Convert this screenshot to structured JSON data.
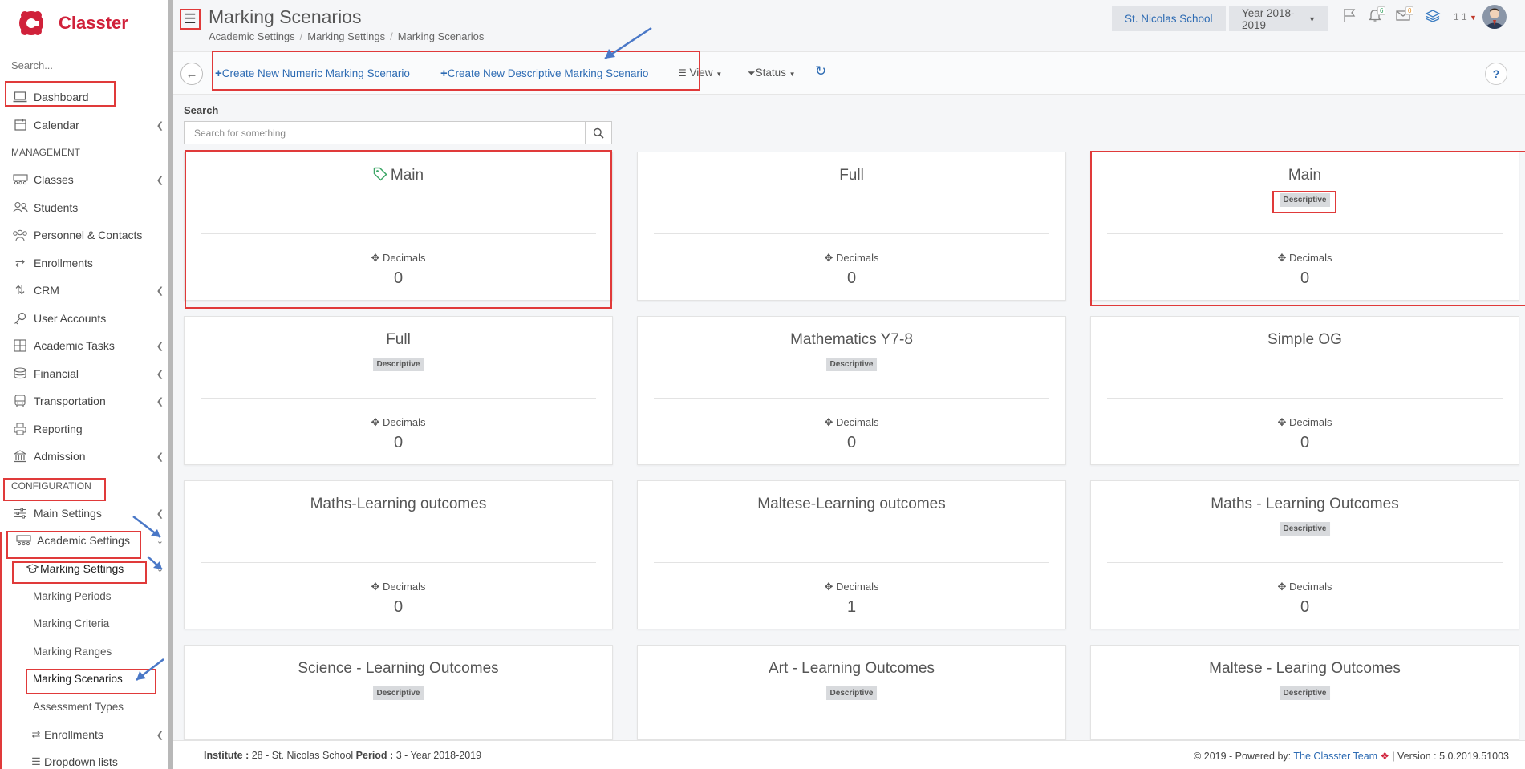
{
  "app": {
    "name": "Classter"
  },
  "sidebar": {
    "search_placeholder": "Search...",
    "items_top": [
      {
        "label": "Dashboard",
        "icon": "laptop-icon"
      },
      {
        "label": "Calendar",
        "icon": "calendar-icon"
      }
    ],
    "management_label": "MANAGEMENT",
    "management": [
      {
        "label": "Classes",
        "icon": "classes-icon"
      },
      {
        "label": "Students",
        "icon": "students-icon"
      },
      {
        "label": "Personnel & Contacts",
        "icon": "personnel-icon"
      },
      {
        "label": "Enrollments",
        "icon": "enrollments-icon"
      },
      {
        "label": "CRM",
        "icon": "crm-icon"
      },
      {
        "label": "User Accounts",
        "icon": "key-icon"
      },
      {
        "label": "Academic Tasks",
        "icon": "tasks-icon"
      },
      {
        "label": "Financial",
        "icon": "financial-icon"
      },
      {
        "label": "Transportation",
        "icon": "bus-icon"
      },
      {
        "label": "Reporting",
        "icon": "printer-icon"
      },
      {
        "label": "Admission",
        "icon": "institution-icon"
      }
    ],
    "configuration_label": "CONFIGURATION",
    "configuration": {
      "main_settings": "Main Settings",
      "academic_settings": "Academic Settings",
      "marking_settings": "Marking Settings",
      "marking_children": [
        "Marking Periods",
        "Marking Criteria",
        "Marking Ranges",
        "Marking Scenarios"
      ],
      "assessment_types": "Assessment Types",
      "enrollments": "Enrollments",
      "dropdown_lists": "Dropdown lists"
    }
  },
  "header": {
    "title": "Marking Scenarios",
    "breadcrumb": [
      "Academic Settings",
      "Marking Settings",
      "Marking Scenarios"
    ],
    "school": "St. Nicolas School",
    "year": "Year 2018-2019",
    "notifications_count": "6",
    "messages_count": "0",
    "user_label": "1 1"
  },
  "toolbar": {
    "create_numeric": "Create New Numeric Marking Scenario",
    "create_descriptive": "Create New Descriptive Marking Scenario",
    "view": "View",
    "status": "Status",
    "help": "?"
  },
  "search": {
    "label": "Search",
    "placeholder": "Search for something"
  },
  "cards": [
    {
      "title": "Main",
      "badge": "",
      "tag_icon": true,
      "decimals_label": "Decimals",
      "decimals": "0"
    },
    {
      "title": "Full",
      "badge": "",
      "decimals_label": "Decimals",
      "decimals": "0"
    },
    {
      "title": "Main",
      "badge": "Descriptive",
      "decimals_label": "Decimals",
      "decimals": "0"
    },
    {
      "title": "Full",
      "badge": "Descriptive",
      "decimals_label": "Decimals",
      "decimals": "0"
    },
    {
      "title": "Mathematics Y7-8",
      "badge": "Descriptive",
      "decimals_label": "Decimals",
      "decimals": "0"
    },
    {
      "title": "Simple OG",
      "badge": "",
      "decimals_label": "Decimals",
      "decimals": "0"
    },
    {
      "title": "Maths-Learning outcomes",
      "badge": "",
      "decimals_label": "Decimals",
      "decimals": "0"
    },
    {
      "title": "Maltese-Learning outcomes",
      "badge": "",
      "decimals_label": "Decimals",
      "decimals": "1"
    },
    {
      "title": "Maths - Learning Outcomes",
      "badge": "Descriptive",
      "decimals_label": "Decimals",
      "decimals": "0"
    },
    {
      "title": "Science - Learning Outcomes",
      "badge": "Descriptive",
      "decimals_label": "",
      "decimals": ""
    },
    {
      "title": "Art - Learning Outcomes",
      "badge": "Descriptive",
      "decimals_label": "",
      "decimals": ""
    },
    {
      "title": "Maltese - Learing Outcomes",
      "badge": "Descriptive",
      "decimals_label": "",
      "decimals": ""
    }
  ],
  "footer": {
    "institute_label": "Institute :",
    "institute_value": "28 - St. Nicolas School",
    "period_label": "Period :",
    "period_value": "3 - Year 2018-2019",
    "copyright": "2019 - Powered by:",
    "team": "The Classter Team",
    "version": "| Version : 5.0.2019.51003"
  },
  "colors": {
    "accent": "#2d6bb3",
    "brand": "#d0213a",
    "highlight": "#e03a3a"
  }
}
